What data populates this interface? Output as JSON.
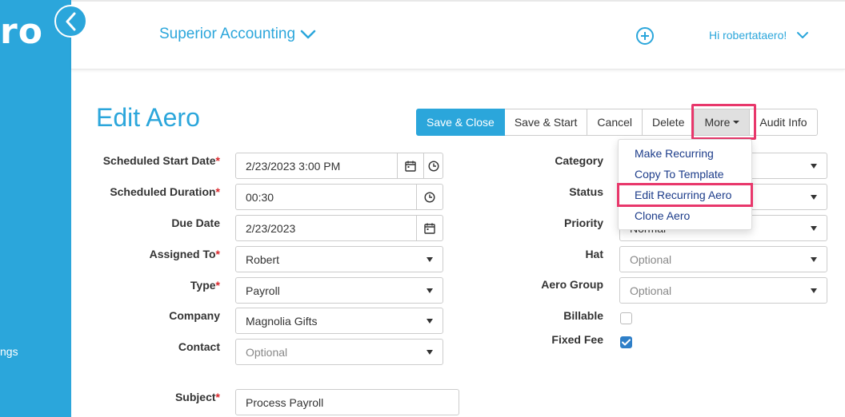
{
  "sidebar": {
    "logo_text": "ro",
    "item_label": "ngs"
  },
  "header": {
    "company": "Superior Accounting",
    "greeting": "Hi robertataero!"
  },
  "page": {
    "title": "Edit Aero"
  },
  "toolbar": {
    "save_close": "Save & Close",
    "save_start": "Save & Start",
    "cancel": "Cancel",
    "delete": "Delete",
    "more": "More",
    "audit_info": "Audit Info"
  },
  "more_menu": [
    "Make Recurring",
    "Copy To Template",
    "Edit Recurring Aero",
    "Clone Aero"
  ],
  "form": {
    "scheduled_start": {
      "label": "Scheduled Start Date",
      "value": "2/23/2023 3:00 PM"
    },
    "scheduled_duration": {
      "label": "Scheduled Duration",
      "value": "00:30"
    },
    "due_date": {
      "label": "Due Date",
      "value": "2/23/2023"
    },
    "assigned_to": {
      "label": "Assigned To",
      "value": "Robert"
    },
    "type": {
      "label": "Type",
      "value": "Payroll"
    },
    "company": {
      "label": "Company",
      "value": "Magnolia Gifts"
    },
    "contact": {
      "label": "Contact",
      "placeholder": "Optional"
    },
    "subject": {
      "label": "Subject",
      "value": "Process Payroll"
    },
    "category": {
      "label": "Category"
    },
    "status": {
      "label": "Status"
    },
    "priority": {
      "label": "Priority",
      "value": "Normal"
    },
    "hat": {
      "label": "Hat",
      "placeholder": "Optional"
    },
    "aero_group": {
      "label": "Aero Group",
      "placeholder": "Optional"
    },
    "billable": {
      "label": "Billable",
      "checked": false
    },
    "fixed_fee": {
      "label": "Fixed Fee",
      "checked": true
    }
  },
  "colors": {
    "brand": "#2ba6db",
    "highlight": "#e8376b",
    "required": "#d9262b",
    "link": "#1c3c8a"
  }
}
